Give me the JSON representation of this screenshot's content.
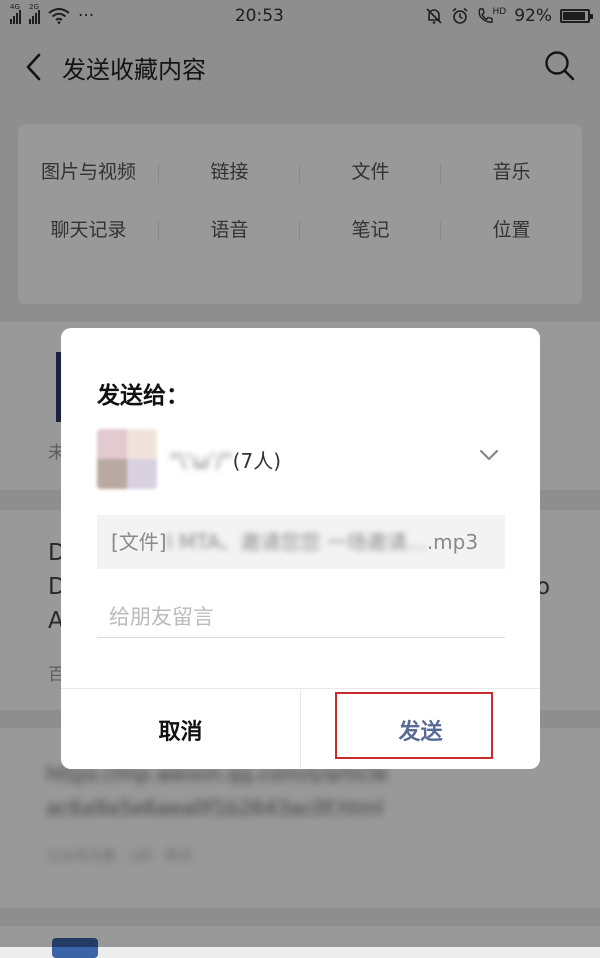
{
  "status_bar": {
    "sig1_tag": "4G",
    "sig2_tag": "2G",
    "dots": "···",
    "time": "20:53",
    "hd": "HD",
    "battery_text": "92%",
    "battery_level": 0.92
  },
  "header": {
    "title": "发送收藏内容"
  },
  "categories": [
    {
      "label": "图片与视频"
    },
    {
      "label": "链接"
    },
    {
      "label": "文件"
    },
    {
      "label": "音乐"
    },
    {
      "label": "聊天记录"
    },
    {
      "label": "语音"
    },
    {
      "label": "笔记"
    },
    {
      "label": "位置"
    }
  ],
  "background_list": {
    "item1_snippet": "未",
    "item2_lines": [
      "D",
      "D",
      "A"
    ],
    "item2_right": "o",
    "item2_meta": "百",
    "item3_line1": "https://mp.weixin.qq.com/s/article",
    "item3_line2": "ac6a9a5e6aea0f1b2643ac0f.html",
    "item3_meta": "公众号文章 · 3月 · 昨天"
  },
  "dialog": {
    "title": "发送给：",
    "recipient_name_blurred": "“\\‘ω’/”",
    "recipient_count": "(7人)",
    "preview_prefix": "[文件]",
    "preview_blurred": "I MTA、邀请您您 一场邀请…",
    "preview_suffix": ".mp3",
    "message_placeholder": "给朋友留言",
    "cancel_label": "取消",
    "send_label": "发送"
  }
}
